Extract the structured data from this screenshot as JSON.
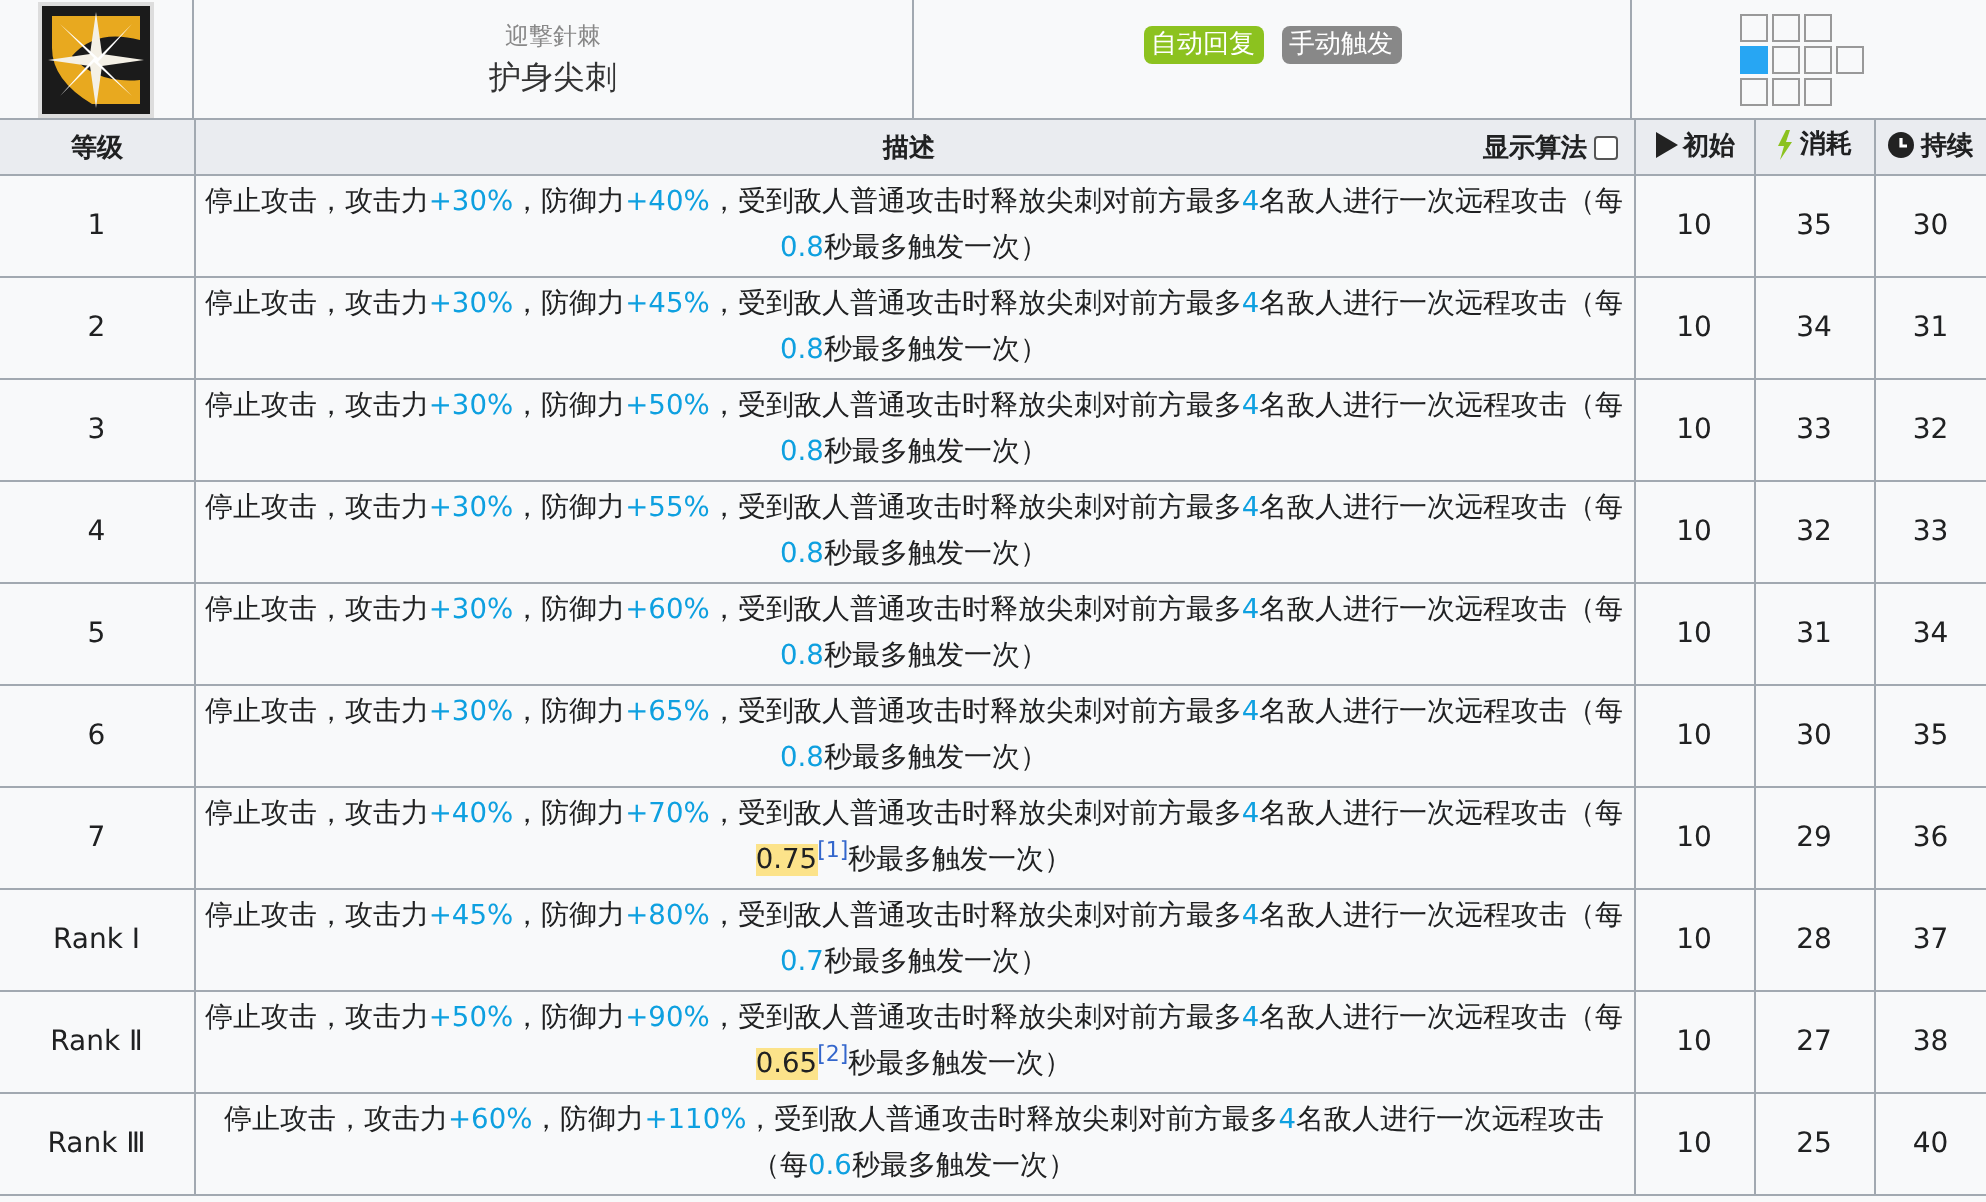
{
  "skill": {
    "subtitle": "迎撃針棘",
    "title": "护身尖刺",
    "tags": [
      {
        "text": "自动回复",
        "color": "#8cc21f"
      },
      {
        "text": "手动触发",
        "color": "#888888"
      }
    ],
    "range": [
      [
        {
          "selected": false
        },
        {
          "selected": false
        },
        {
          "selected": false
        }
      ],
      [
        {
          "selected": true
        },
        {
          "selected": false
        },
        {
          "selected": false
        },
        {
          "selected": false
        }
      ],
      [
        {
          "selected": false
        },
        {
          "selected": false
        },
        {
          "selected": false
        }
      ]
    ]
  },
  "table": {
    "columns": {
      "level": "等级",
      "description": "描述",
      "show_formula": {
        "label": "显示算法",
        "checked": false
      },
      "initial": "初始",
      "cost": "消耗",
      "duration": "持续"
    },
    "rows": [
      {
        "level": "1",
        "desc": [
          {
            "kind": "plain",
            "text": "停止攻击，攻击力"
          },
          {
            "kind": "value",
            "text": "+30%"
          },
          {
            "kind": "plain",
            "text": "，防御力"
          },
          {
            "kind": "value",
            "text": "+40%"
          },
          {
            "kind": "plain",
            "text": "，受到敌人普通攻击时释放尖刺对前方最多"
          },
          {
            "kind": "value",
            "text": "4"
          },
          {
            "kind": "plain",
            "text": "名敌人进行一次远程攻击（每"
          },
          {
            "kind": "value",
            "text": "0.8"
          },
          {
            "kind": "plain",
            "text": "秒最多触发一次）"
          }
        ],
        "initial": "10",
        "cost": "35",
        "duration": "30"
      },
      {
        "level": "2",
        "desc": [
          {
            "kind": "plain",
            "text": "停止攻击，攻击力"
          },
          {
            "kind": "value",
            "text": "+30%"
          },
          {
            "kind": "plain",
            "text": "，防御力"
          },
          {
            "kind": "value",
            "text": "+45%"
          },
          {
            "kind": "plain",
            "text": "，受到敌人普通攻击时释放尖刺对前方最多"
          },
          {
            "kind": "value",
            "text": "4"
          },
          {
            "kind": "plain",
            "text": "名敌人进行一次远程攻击（每"
          },
          {
            "kind": "value",
            "text": "0.8"
          },
          {
            "kind": "plain",
            "text": "秒最多触发一次）"
          }
        ],
        "initial": "10",
        "cost": "34",
        "duration": "31"
      },
      {
        "level": "3",
        "desc": [
          {
            "kind": "plain",
            "text": "停止攻击，攻击力"
          },
          {
            "kind": "value",
            "text": "+30%"
          },
          {
            "kind": "plain",
            "text": "，防御力"
          },
          {
            "kind": "value",
            "text": "+50%"
          },
          {
            "kind": "plain",
            "text": "，受到敌人普通攻击时释放尖刺对前方最多"
          },
          {
            "kind": "value",
            "text": "4"
          },
          {
            "kind": "plain",
            "text": "名敌人进行一次远程攻击（每"
          },
          {
            "kind": "value",
            "text": "0.8"
          },
          {
            "kind": "plain",
            "text": "秒最多触发一次）"
          }
        ],
        "initial": "10",
        "cost": "33",
        "duration": "32"
      },
      {
        "level": "4",
        "desc": [
          {
            "kind": "plain",
            "text": "停止攻击，攻击力"
          },
          {
            "kind": "value",
            "text": "+30%"
          },
          {
            "kind": "plain",
            "text": "，防御力"
          },
          {
            "kind": "value",
            "text": "+55%"
          },
          {
            "kind": "plain",
            "text": "，受到敌人普通攻击时释放尖刺对前方最多"
          },
          {
            "kind": "value",
            "text": "4"
          },
          {
            "kind": "plain",
            "text": "名敌人进行一次远程攻击（每"
          },
          {
            "kind": "value",
            "text": "0.8"
          },
          {
            "kind": "plain",
            "text": "秒最多触发一次）"
          }
        ],
        "initial": "10",
        "cost": "32",
        "duration": "33"
      },
      {
        "level": "5",
        "desc": [
          {
            "kind": "plain",
            "text": "停止攻击，攻击力"
          },
          {
            "kind": "value",
            "text": "+30%"
          },
          {
            "kind": "plain",
            "text": "，防御力"
          },
          {
            "kind": "value",
            "text": "+60%"
          },
          {
            "kind": "plain",
            "text": "，受到敌人普通攻击时释放尖刺对前方最多"
          },
          {
            "kind": "value",
            "text": "4"
          },
          {
            "kind": "plain",
            "text": "名敌人进行一次远程攻击（每"
          },
          {
            "kind": "value",
            "text": "0.8"
          },
          {
            "kind": "plain",
            "text": "秒最多触发一次）"
          }
        ],
        "initial": "10",
        "cost": "31",
        "duration": "34"
      },
      {
        "level": "6",
        "desc": [
          {
            "kind": "plain",
            "text": "停止攻击，攻击力"
          },
          {
            "kind": "value",
            "text": "+30%"
          },
          {
            "kind": "plain",
            "text": "，防御力"
          },
          {
            "kind": "value",
            "text": "+65%"
          },
          {
            "kind": "plain",
            "text": "，受到敌人普通攻击时释放尖刺对前方最多"
          },
          {
            "kind": "value",
            "text": "4"
          },
          {
            "kind": "plain",
            "text": "名敌人进行一次远程攻击（每"
          },
          {
            "kind": "value",
            "text": "0.8"
          },
          {
            "kind": "plain",
            "text": "秒最多触发一次）"
          }
        ],
        "initial": "10",
        "cost": "30",
        "duration": "35"
      },
      {
        "level": "7",
        "desc": [
          {
            "kind": "plain",
            "text": "停止攻击，攻击力"
          },
          {
            "kind": "value",
            "text": "+40%"
          },
          {
            "kind": "plain",
            "text": "，防御力"
          },
          {
            "kind": "value",
            "text": "+70%"
          },
          {
            "kind": "plain",
            "text": "，受到敌人普通攻击时释放尖刺对前方最多"
          },
          {
            "kind": "value",
            "text": "4"
          },
          {
            "kind": "plain",
            "text": "名敌人进行一次远程攻击（每"
          },
          {
            "kind": "highlight",
            "text": "0.75"
          },
          {
            "kind": "ref",
            "text": "[1]"
          },
          {
            "kind": "plain",
            "text": "秒最多触发一次）"
          }
        ],
        "initial": "10",
        "cost": "29",
        "duration": "36"
      },
      {
        "level": "Rank Ⅰ",
        "desc": [
          {
            "kind": "plain",
            "text": "停止攻击，攻击力"
          },
          {
            "kind": "value",
            "text": "+45%"
          },
          {
            "kind": "plain",
            "text": "，防御力"
          },
          {
            "kind": "value",
            "text": "+80%"
          },
          {
            "kind": "plain",
            "text": "，受到敌人普通攻击时释放尖刺对前方最多"
          },
          {
            "kind": "value",
            "text": "4"
          },
          {
            "kind": "plain",
            "text": "名敌人进行一次远程攻击（每"
          },
          {
            "kind": "value",
            "text": "0.7"
          },
          {
            "kind": "plain",
            "text": "秒最多触发一次）"
          }
        ],
        "initial": "10",
        "cost": "28",
        "duration": "37"
      },
      {
        "level": "Rank Ⅱ",
        "desc": [
          {
            "kind": "plain",
            "text": "停止攻击，攻击力"
          },
          {
            "kind": "value",
            "text": "+50%"
          },
          {
            "kind": "plain",
            "text": "，防御力"
          },
          {
            "kind": "value",
            "text": "+90%"
          },
          {
            "kind": "plain",
            "text": "，受到敌人普通攻击时释放尖刺对前方最多"
          },
          {
            "kind": "value",
            "text": "4"
          },
          {
            "kind": "plain",
            "text": "名敌人进行一次远程攻击（每"
          },
          {
            "kind": "highlight",
            "text": "0.65"
          },
          {
            "kind": "ref",
            "text": "[2]"
          },
          {
            "kind": "plain",
            "text": "秒最多触发一次）"
          }
        ],
        "initial": "10",
        "cost": "27",
        "duration": "38"
      },
      {
        "level": "Rank Ⅲ",
        "desc": [
          {
            "kind": "plain",
            "text": "停止攻击，攻击力"
          },
          {
            "kind": "value",
            "text": "+60%"
          },
          {
            "kind": "plain",
            "text": "，防御力"
          },
          {
            "kind": "value",
            "text": "+110%"
          },
          {
            "kind": "plain",
            "text": "，受到敌人普通攻击时释放尖刺对前方最多"
          },
          {
            "kind": "value",
            "text": "4"
          },
          {
            "kind": "plain",
            "text": "名敌人进行一次远程攻击（每"
          },
          {
            "kind": "value",
            "text": "0.6"
          },
          {
            "kind": "plain",
            "text": "秒最多触发一次）"
          }
        ],
        "initial": "10",
        "cost": "25",
        "duration": "40"
      }
    ]
  }
}
